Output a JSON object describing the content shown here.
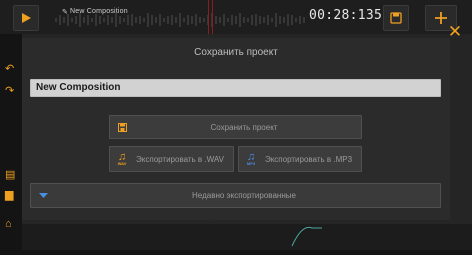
{
  "topbar": {
    "song_title": "New Composition",
    "time": "00:28:135"
  },
  "dialog": {
    "title": "Сохранить проект",
    "project_name": "New Composition",
    "save_label": "Сохранить проект",
    "export_wav_label": "Экспортировать в .WAV",
    "export_mp3_label": "Экспортировать в .MP3",
    "wav_badge": "WAV",
    "mp3_badge": "MP3",
    "recent_label": "Недавно экспортированные"
  },
  "colors": {
    "accent": "#f0a020",
    "mp3_accent": "#4a8fe0"
  },
  "icons": [
    "play-icon",
    "pencil-icon",
    "save-icon",
    "add-icon",
    "close-icon",
    "undo-icon",
    "redo-icon",
    "file-icon",
    "folder-icon",
    "home-icon",
    "music-note-icon",
    "chevron-down-icon"
  ]
}
